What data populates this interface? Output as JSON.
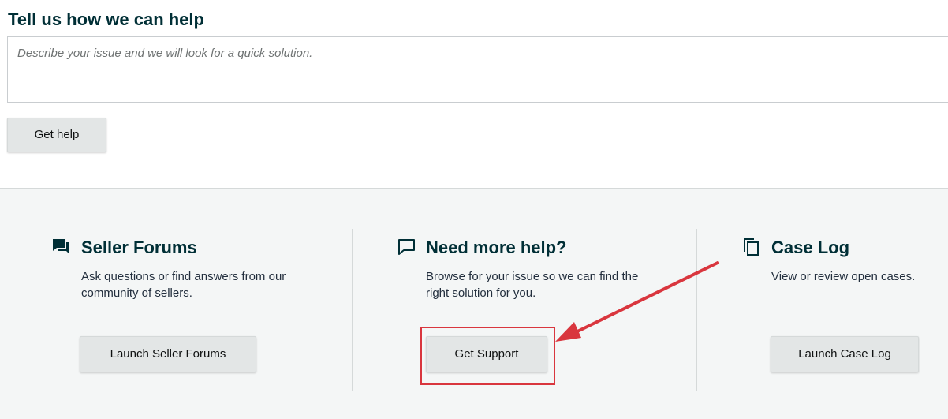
{
  "help": {
    "title": "Tell us how we can help",
    "issue_placeholder": "Describe your issue and we will look for a quick solution.",
    "issue_value": "",
    "get_help_label": "Get help"
  },
  "cards": {
    "forums": {
      "icon": "forum-chat-icon",
      "title": "Seller Forums",
      "description": "Ask questions or find answers from our community of sellers.",
      "button_label": "Launch Seller Forums"
    },
    "more_help": {
      "icon": "chat-bubble-icon",
      "title": "Need more help?",
      "description": "Browse for your issue so we can find the right solution for you.",
      "button_label": "Get Support"
    },
    "case_log": {
      "icon": "copy-document-icon",
      "title": "Case Log",
      "description": "View or review open cases.",
      "button_label": "Launch Case Log"
    }
  },
  "annotation": {
    "color": "#d9363e",
    "target": "Get Support"
  }
}
